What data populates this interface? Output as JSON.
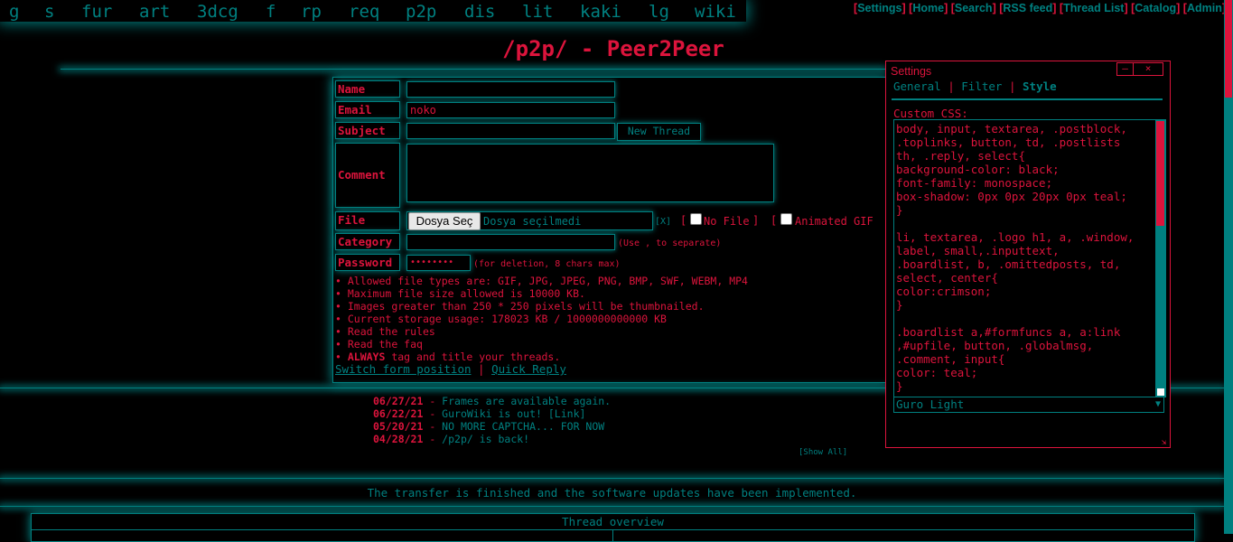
{
  "boards": [
    "g",
    "s",
    "fur",
    "art",
    "3dcg",
    "f",
    "rp",
    "req",
    "p2p",
    "dis",
    "lit",
    "kaki",
    "lg",
    "wiki"
  ],
  "toplinks": [
    "Settings",
    "Home",
    "Search",
    "RSS feed",
    "Thread List",
    "Catalog",
    "Admin"
  ],
  "title": "/p2p/ - Peer2Peer",
  "form": {
    "name_label": "Name",
    "email_label": "Email",
    "email_value": "noko",
    "subject_label": "Subject",
    "new_thread_button": "New Thread",
    "comment_label": "Comment",
    "file_label": "File",
    "file_button": "Dosya Seç",
    "file_status": "Dosya seçilmedi",
    "file_clear": "[X]",
    "no_file_label": "No File",
    "animated_gif_label": "Animated GIF",
    "category_label": "Category",
    "category_hint": "(Use , to separate)",
    "password_label": "Password",
    "password_value": "••••••••",
    "password_hint": "(for deletion, 8 chars max)",
    "rules": [
      "Allowed file types are: GIF, JPG, JPEG, PNG, BMP, SWF, WEBM, MP4",
      "Maximum file size allowed is 10000 KB.",
      "Images greater than 250 * 250 pixels will be thumbnailed.",
      "Current storage usage: 178023 KB / 1000000000000 KB",
      "Read the rules",
      "Read the faq"
    ],
    "rule_always_bold": "ALWAYS",
    "rule_always_rest": " tag and title your threads.",
    "switch_position": "Switch form position",
    "quick_reply": "Quick Reply"
  },
  "news": [
    {
      "date": "06/27/21",
      "text": "Frames are available again.",
      "link": ""
    },
    {
      "date": "06/22/21",
      "text": "GuroWiki is out! ",
      "link": "[Link]"
    },
    {
      "date": "05/20/21",
      "text": "NO MORE CAPTCHA... FOR NOW",
      "link": ""
    },
    {
      "date": "04/28/21",
      "text": "/p2p/ is back!",
      "link": ""
    }
  ],
  "show_all": "[Show All]",
  "global_message": "The transfer is finished and the software updates have been implemented.",
  "thread_overview": "Thread overview",
  "settings": {
    "title": "Settings",
    "minimize": "—",
    "close": "×",
    "tabs": [
      "General",
      "Filter",
      "Style"
    ],
    "active_tab": "Style",
    "custom_css_label": "Custom CSS:",
    "custom_css": "body, input, textarea, .postblock,\n.toplinks, button, td, .postlists\nth, .reply, select{\nbackground-color: black;\nfont-family: monospace;\nbox-shadow: 0px 0px 20px 0px teal;\n}\n\nli, textarea, .logo h1, a, .window,\nlabel, small,.inputtext,\n.boardlist, b, .omittedposts, td,\nselect, center{\ncolor:crimson;\n}\n\n.boardlist a,#formfuncs a, a:link\n,#upfile, button, .globalmsg,\n.comment, input{\ncolor: teal;\n}",
    "theme_value": "Guro Light"
  },
  "colors": {
    "accent": "#dc143c",
    "secondary": "#008080",
    "background": "#000000"
  }
}
